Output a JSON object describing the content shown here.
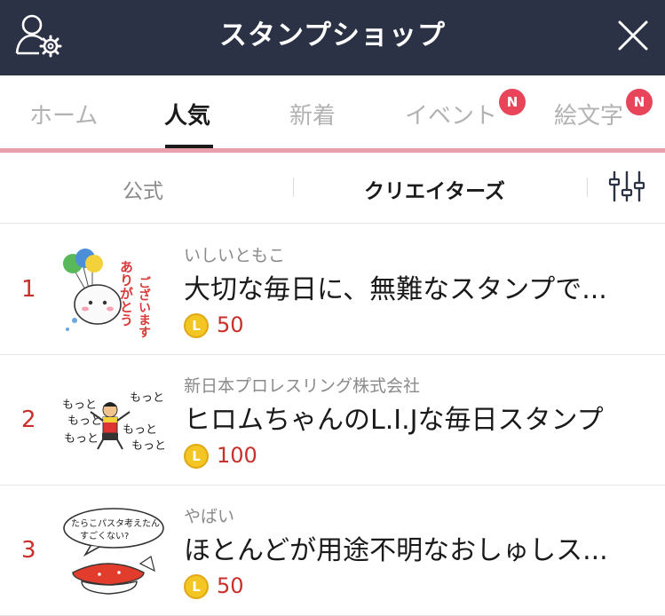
{
  "header": {
    "title": "スタンプショップ",
    "left_icon": "user-settings-icon",
    "right_icon": "close-icon"
  },
  "tabs": [
    {
      "label": "ホーム",
      "active": false,
      "badge": ""
    },
    {
      "label": "人気",
      "active": true,
      "badge": ""
    },
    {
      "label": "新着",
      "active": false,
      "badge": ""
    },
    {
      "label": "イベント",
      "active": false,
      "badge": "N"
    },
    {
      "label": "絵文字",
      "active": false,
      "badge": "N"
    }
  ],
  "subtabs": {
    "official": "公式",
    "creators": "クリエイターズ",
    "filter_icon": "filter-sliders-icon"
  },
  "items": [
    {
      "rank": "1",
      "author": "いしいともこ",
      "title": "大切な毎日に、無難なスタンプで...",
      "coin": "L",
      "price": "50",
      "thumb_text": "ありがとうございます"
    },
    {
      "rank": "2",
      "author": "新日本プロレスリング株式会社",
      "title": "ヒロムちゃんのL.I.Jな毎日スタンプ",
      "coin": "L",
      "price": "100",
      "thumb_text": "もっと"
    },
    {
      "rank": "3",
      "author": "やばい",
      "title": "ほとんどが用途不明なおしゅしス...",
      "coin": "L",
      "price": "50",
      "thumb_text": "たらこパスタ考えたんすごくない?"
    }
  ],
  "colors": {
    "header_bg": "#2b3245",
    "accent_red": "#c9302c",
    "badge_red": "#e8445a",
    "tab_underline_pink": "#e8a0ad",
    "coin_gold": "#f3c624"
  }
}
